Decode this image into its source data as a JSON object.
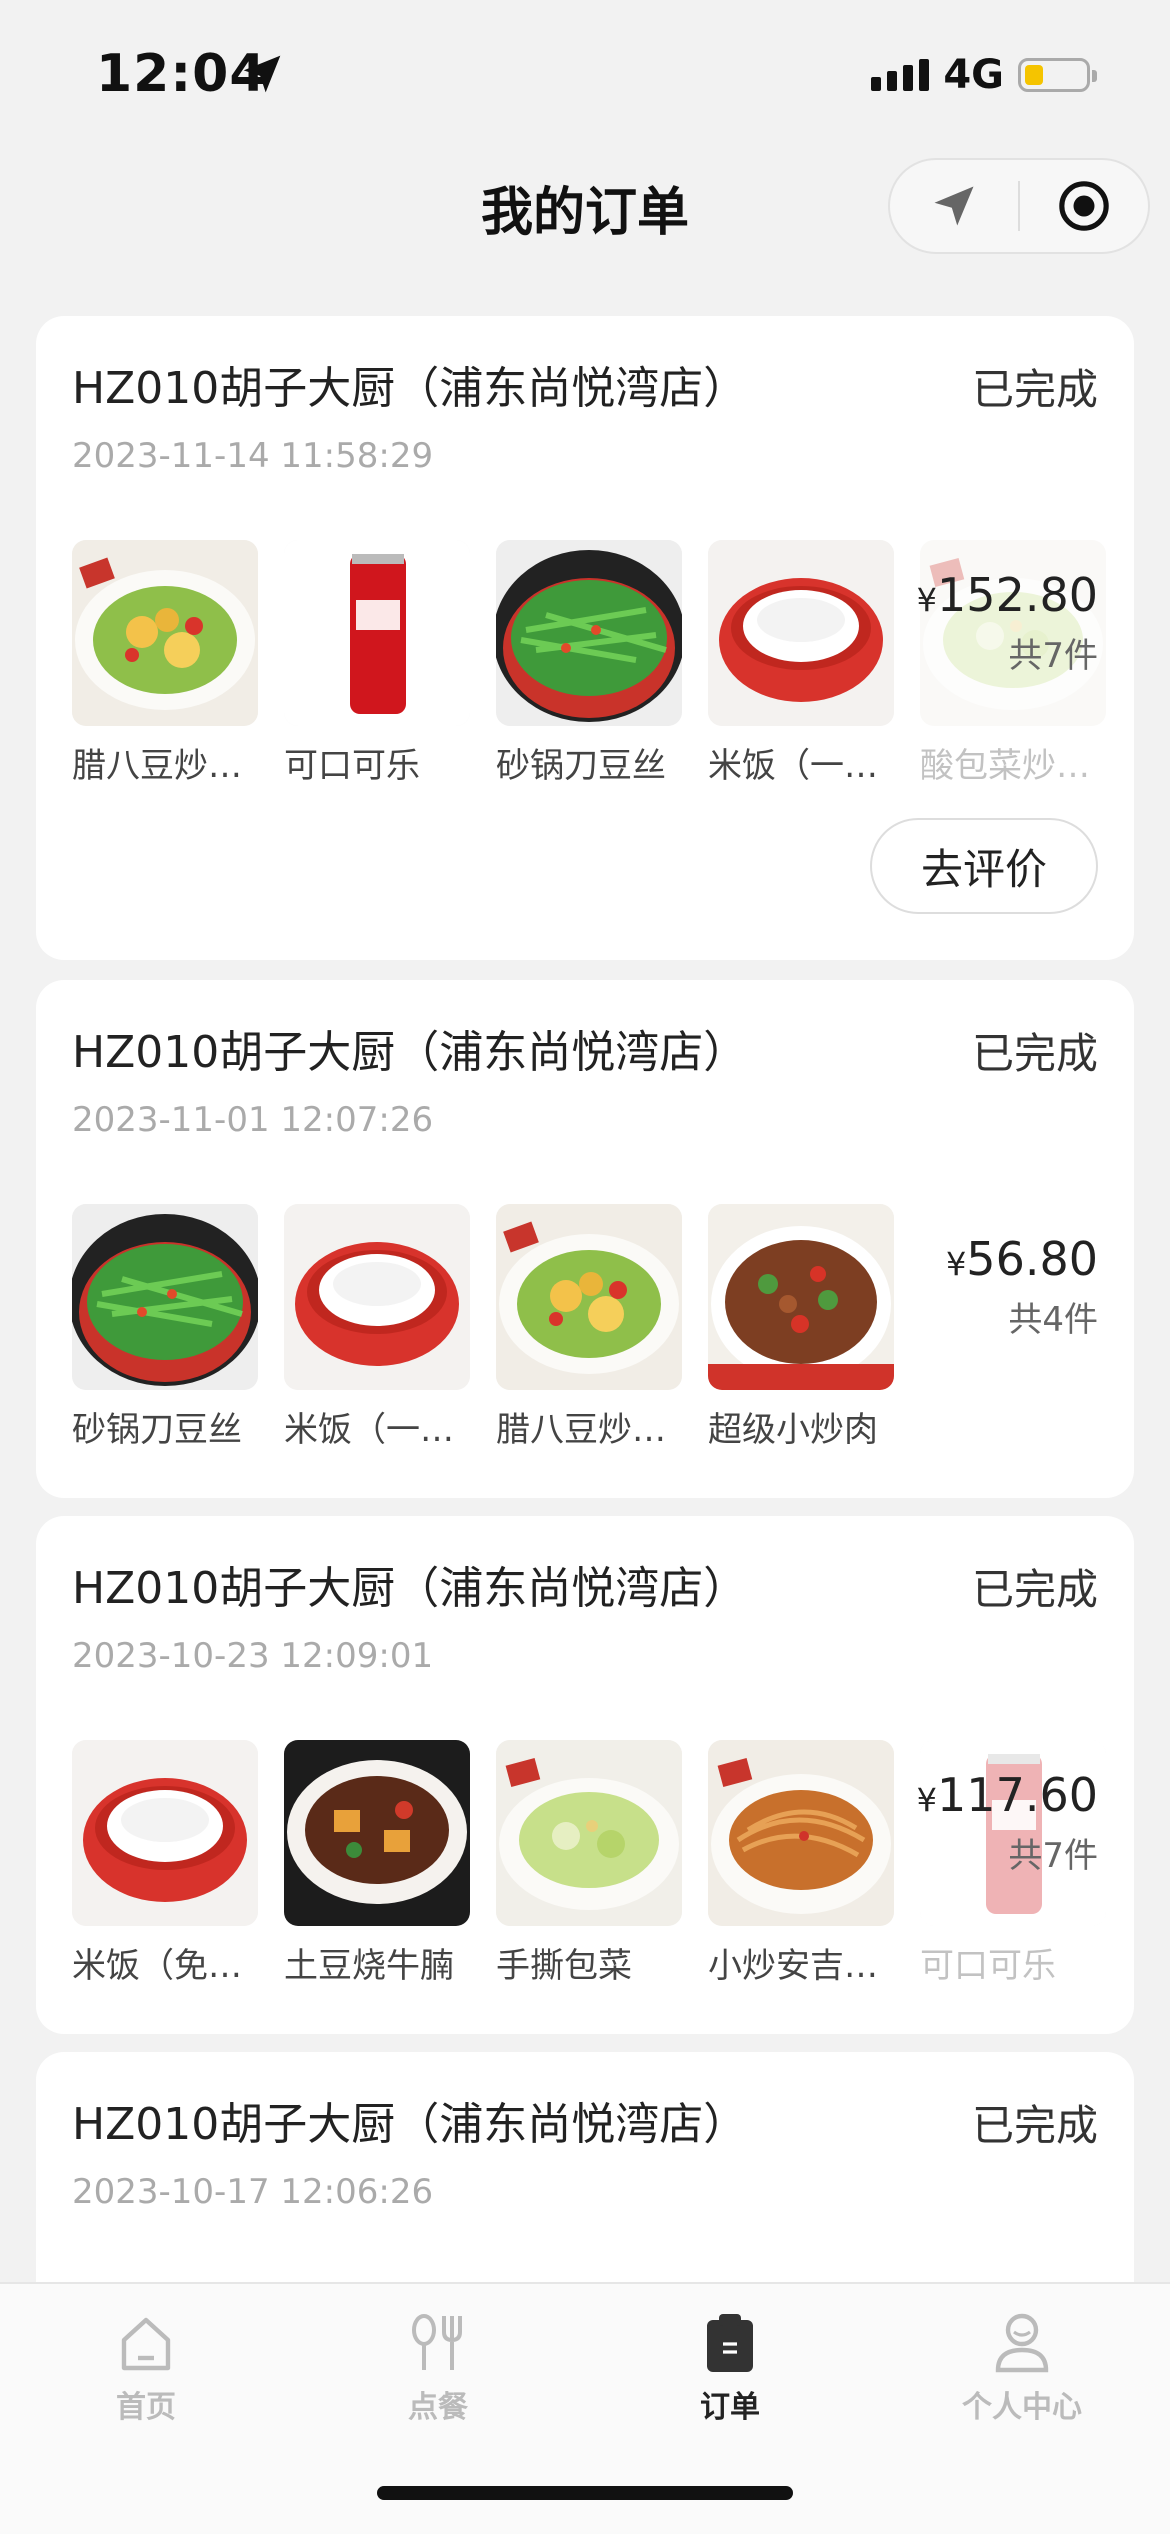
{
  "status_bar": {
    "time": "12:04",
    "network": "4G",
    "battery_color": "#f5c400"
  },
  "header": {
    "title": "我的订单"
  },
  "capsule": {
    "left_icon": "location-arrow-icon",
    "right_icon": "target-icon"
  },
  "orders": [
    {
      "shop": "HZ010胡子大厨（浦东尚悦湾店）",
      "status": "已完成",
      "date": "2023-11-14 11:58:29",
      "items": [
        {
          "name": "腊八豆炒…",
          "icon": "egg-bean-dish-icon"
        },
        {
          "name": "可口可乐",
          "icon": "cola-can-icon"
        },
        {
          "name": "砂锅刀豆丝",
          "icon": "green-bean-pot-icon"
        },
        {
          "name": "米饭（一…",
          "icon": "rice-bowl-icon"
        },
        {
          "name": "酸包菜炒…",
          "icon": "cabbage-dish-icon"
        }
      ],
      "price_symbol": "¥",
      "price": "152.80",
      "count": "共7件",
      "review_button": "去评价"
    },
    {
      "shop": "HZ010胡子大厨（浦东尚悦湾店）",
      "status": "已完成",
      "date": "2023-11-01 12:07:26",
      "items": [
        {
          "name": "砂锅刀豆丝",
          "icon": "green-bean-pot-icon"
        },
        {
          "name": "米饭（一…",
          "icon": "rice-bowl-icon"
        },
        {
          "name": "腊八豆炒…",
          "icon": "egg-bean-dish-icon"
        },
        {
          "name": "超级小炒肉",
          "icon": "stir-fry-pork-icon"
        }
      ],
      "price_symbol": "¥",
      "price": "56.80",
      "count": "共4件"
    },
    {
      "shop": "HZ010胡子大厨（浦东尚悦湾店）",
      "status": "已完成",
      "date": "2023-10-23 12:09:01",
      "items": [
        {
          "name": "米饭（免…",
          "icon": "rice-bowl-icon"
        },
        {
          "name": "土豆烧牛腩",
          "icon": "beef-potato-icon"
        },
        {
          "name": "手撕包菜",
          "icon": "cabbage-dish-icon"
        },
        {
          "name": "小炒安吉…",
          "icon": "noodle-dish-icon"
        },
        {
          "name": "可口可乐",
          "icon": "cola-can-icon"
        }
      ],
      "price_symbol": "¥",
      "price": "117.60",
      "count": "共7件"
    },
    {
      "shop": "HZ010胡子大厨（浦东尚悦湾店）",
      "status": "已完成",
      "date": "2023-10-17 12:06:26"
    }
  ],
  "tabbar": [
    {
      "label": "首页",
      "icon": "home-icon",
      "active": false
    },
    {
      "label": "点餐",
      "icon": "utensils-icon",
      "active": false
    },
    {
      "label": "订单",
      "icon": "clipboard-icon",
      "active": true
    },
    {
      "label": "个人中心",
      "icon": "person-icon",
      "active": false
    }
  ]
}
